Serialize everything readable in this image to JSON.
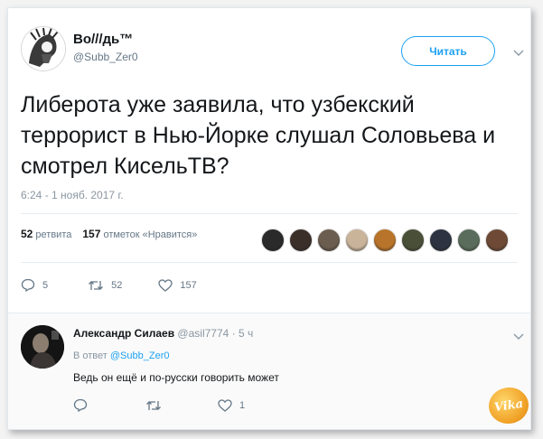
{
  "tweet": {
    "display_name": "Во///дь™",
    "handle": "@Subb_Zer0",
    "follow_label": "Читать",
    "text": "Либерота уже заявила, что узбекский террорист в Нью-Йорке слушал Соловьева и смотрел КисельТВ?",
    "timestamp": "6:24 - 1 нояб. 2017 г.",
    "stats": {
      "retweets_count": "52",
      "retweets_label": "ретвита",
      "likes_count": "157",
      "likes_label": "отметок «Нравится»"
    },
    "liker_avatars": [
      "#2a2a2a",
      "#3b2f2a",
      "#6b5d4f",
      "#c9b49a",
      "#b8742a",
      "#4a5038",
      "#2d3340",
      "#5a6d5c",
      "#6e4a36"
    ],
    "actions": {
      "reply_count": "5",
      "retweet_count": "52",
      "like_count": "157"
    }
  },
  "reply": {
    "name": "Александр Силаев",
    "handle": "@asil7774",
    "age": "· 5 ч",
    "reply_to_prefix": "В ответ",
    "reply_to_mention": "@Subb_Zer0",
    "text": "Ведь он ещё и по-русски говорить может",
    "actions": {
      "like_count": "1"
    }
  },
  "watermark": {
    "text": "Vika"
  },
  "colors": {
    "accent": "#1da1f2",
    "muted": "#657786",
    "divider": "#e6ecf0"
  }
}
